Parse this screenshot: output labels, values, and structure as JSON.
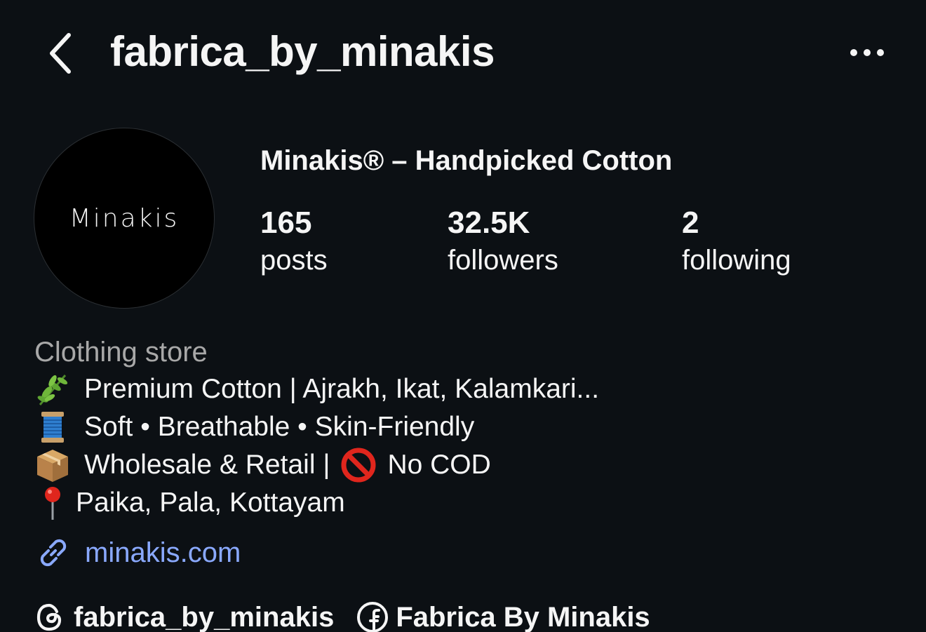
{
  "header": {
    "username": "fabrica_by_minakis"
  },
  "profile": {
    "avatar_logo_text": "Minakis",
    "display_name": "Minakis® – Handpicked Cotton",
    "stats": {
      "posts_count": "165",
      "posts_label": "posts",
      "followers_count": "32.5K",
      "followers_label": "followers",
      "following_count": "2",
      "following_label": "following"
    }
  },
  "bio": {
    "category": "Clothing store",
    "line1": "Premium Cotton | Ajrakh, Ikat, Kalamkari...",
    "line2": "Soft • Breathable • Skin-Friendly",
    "line3_a": "Wholesale & Retail |",
    "line3_b": "No COD",
    "line4": "Paika, Pala, Kottayam",
    "icons": [
      "herb-icon",
      "thread-spool-icon",
      "package-icon",
      "prohibited-icon",
      "location-pin-icon"
    ]
  },
  "link": {
    "text": "minakis.com",
    "color": "#8aa9ff"
  },
  "social": {
    "threads_handle": "fabrica_by_minakis",
    "facebook_name": "Fabrica By Minakis"
  },
  "colors": {
    "background": "#0c1014",
    "text": "#f5f5f5",
    "muted": "#a8a8a8"
  }
}
